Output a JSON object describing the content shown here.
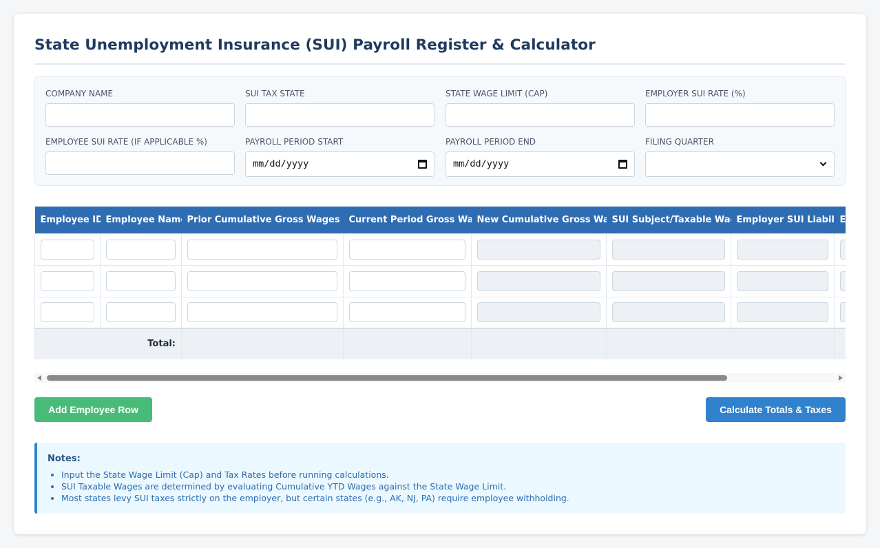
{
  "title": "State Unemployment Insurance (SUI) Payroll Register & Calculator",
  "form": {
    "company_name": {
      "label": "Company Name",
      "value": ""
    },
    "sui_tax_state": {
      "label": "SUI Tax State",
      "value": ""
    },
    "state_wage_limit": {
      "label": "State Wage Limit (Cap)",
      "value": ""
    },
    "employer_sui_rate": {
      "label": "Employer SUI Rate (%)",
      "value": ""
    },
    "employee_sui_rate": {
      "label": "Employee SUI Rate (If Applicable %)",
      "value": ""
    },
    "payroll_period_start": {
      "label": "Payroll Period Start",
      "value": "mm/dd/yyyy"
    },
    "payroll_period_end": {
      "label": "Payroll Period End",
      "value": "mm/dd/yyyy"
    },
    "filing_quarter": {
      "label": "Filing Quarter",
      "value": ""
    }
  },
  "table": {
    "columns": [
      "Employee ID",
      "Employee Name",
      "Prior Cumulative Gross Wages (YTD)",
      "Current Period Gross Wages",
      "New Cumulative Gross Wages",
      "SUI Subject/Taxable Wages",
      "Employer SUI Liability",
      "E"
    ],
    "row_count": 3,
    "total_label": "Total:"
  },
  "buttons": {
    "add_row": "Add Employee Row",
    "calculate": "Calculate Totals & Taxes"
  },
  "notes": {
    "heading": "Notes:",
    "items": [
      "Input the State Wage Limit (Cap) and Tax Rates before running calculations.",
      "SUI Taxable Wages are determined by evaluating Cumulative YTD Wages against the State Wage Limit.",
      "Most states levy SUI taxes strictly on the employer, but certain states (e.g., AK, NJ, PA) require employee withholding."
    ]
  },
  "colors": {
    "header_bg": "#2f6db3",
    "add_button": "#48bb78",
    "calc_button": "#3182ce",
    "title": "#1e3a5f"
  }
}
